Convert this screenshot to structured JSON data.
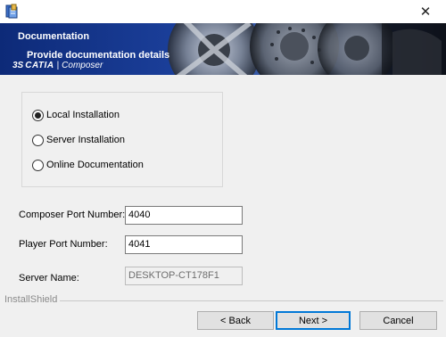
{
  "window": {
    "close_glyph": "✕",
    "app_icon": "installer-icon"
  },
  "banner": {
    "title": "Documentation",
    "subtitle": "Provide documentation details",
    "brand_ds": "3S",
    "brand_name": "CATIA",
    "brand_separator": "|",
    "brand_product": "Composer"
  },
  "options": {
    "items": [
      {
        "label": "Local Installation",
        "selected": true
      },
      {
        "label": "Server Installation",
        "selected": false
      },
      {
        "label": "Online Documentation",
        "selected": false
      }
    ]
  },
  "fields": {
    "composer_port_label": "Composer Port Number:",
    "composer_port_value": "4040",
    "player_port_label": "Player Port Number:",
    "player_port_value": "4041",
    "server_name_label": "Server Name:",
    "server_name_value": "DESKTOP-CT178F1"
  },
  "footer": {
    "installshield": "InstallShield",
    "back_label": "< Back",
    "next_label": "Next >",
    "cancel_label": "Cancel"
  }
}
